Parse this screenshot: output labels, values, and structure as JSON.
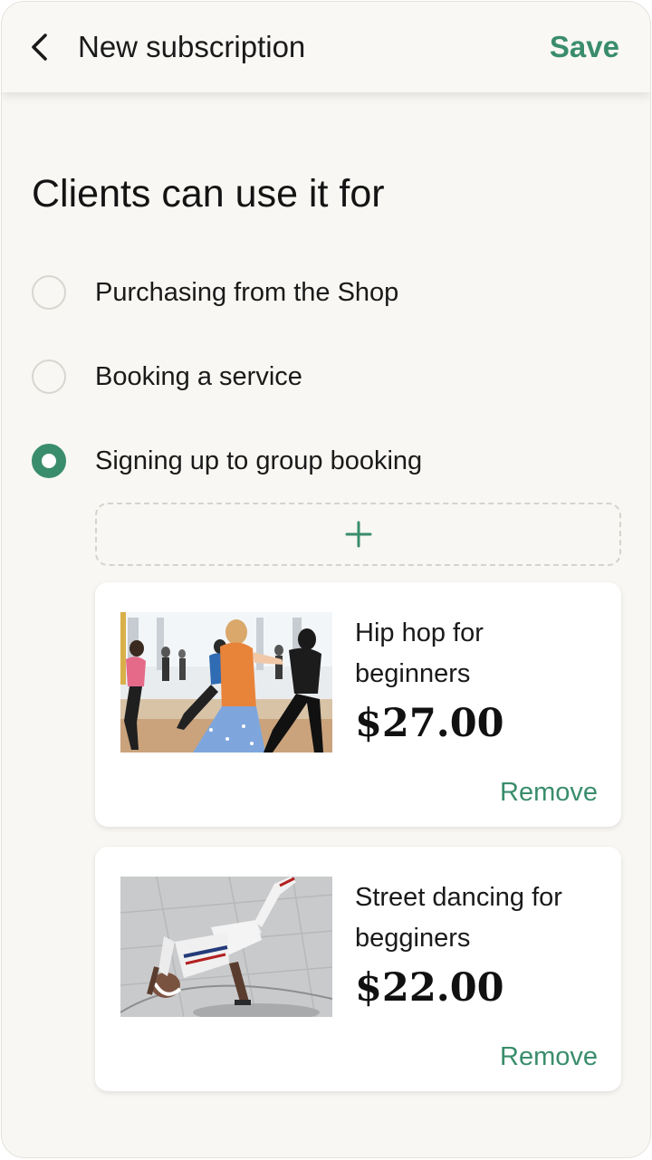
{
  "header": {
    "back_icon": "chevron-left-icon",
    "title": "New subscription",
    "save_label": "Save"
  },
  "section": {
    "title": "Clients can use it for"
  },
  "options": [
    {
      "label": "Purchasing from the Shop",
      "selected": false
    },
    {
      "label": "Booking a service",
      "selected": false
    },
    {
      "label": "Signing up to group booking",
      "selected": true
    }
  ],
  "add_button": {
    "icon": "plus-icon"
  },
  "cards": [
    {
      "name": "Hip hop for beginners",
      "price": "$27.00",
      "remove_label": "Remove",
      "image": "dance-class-photo"
    },
    {
      "name": "Street dancing for begginers",
      "price": "$22.00",
      "remove_label": "Remove",
      "image": "breakdancer-photo"
    }
  ],
  "colors": {
    "accent": "#3a8d6c",
    "background": "#f8f7f3",
    "card": "#ffffff"
  }
}
